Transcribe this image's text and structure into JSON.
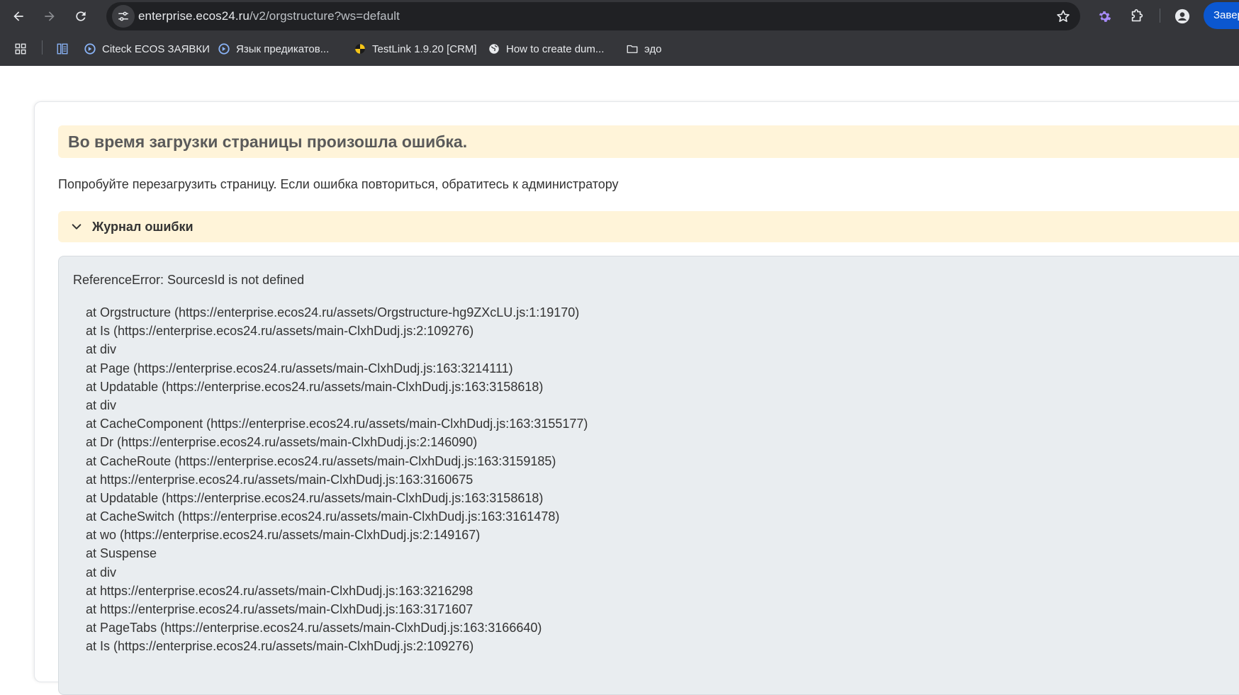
{
  "browser": {
    "url_host": "enterprise.ecos24.ru",
    "url_path": "/v2/orgstructure?ws=default",
    "finish_button_label": "Завер",
    "accent_color": "#0b57d0",
    "bookmarks": [
      {
        "label": "",
        "icon": "apps-grid-icon"
      },
      {
        "label": "",
        "icon": "reading-list-icon"
      },
      {
        "label": "Citeck ECOS ЗАЯВКИ",
        "icon": "citeck-logo-icon"
      },
      {
        "label": "Язык предикатов...",
        "icon": "citeck-logo-icon"
      },
      {
        "label": "TestLink 1.9.20 [CRM]",
        "icon": "testlink-logo-icon"
      },
      {
        "label": "How to create dum...",
        "icon": "globe-icon"
      },
      {
        "label": "эдо",
        "icon": "folder-icon"
      }
    ]
  },
  "error_page": {
    "title": "Во время загрузки страницы произошла ошибка.",
    "hint": "Попробуйте перезагрузить страницу. Если ошибка повториться, обратитесь к администратору",
    "log_toggle_label": "Журнал ошибки",
    "banner_color": "#fff4d9",
    "log_message": "ReferenceError: SourcesId is not defined",
    "stack": [
      "at Orgstructure (https://enterprise.ecos24.ru/assets/Orgstructure-hg9ZXcLU.js:1:19170)",
      "at Is (https://enterprise.ecos24.ru/assets/main-ClxhDudj.js:2:109276)",
      "at div",
      "at Page (https://enterprise.ecos24.ru/assets/main-ClxhDudj.js:163:3214111)",
      "at Updatable (https://enterprise.ecos24.ru/assets/main-ClxhDudj.js:163:3158618)",
      "at div",
      "at CacheComponent (https://enterprise.ecos24.ru/assets/main-ClxhDudj.js:163:3155177)",
      "at Dr (https://enterprise.ecos24.ru/assets/main-ClxhDudj.js:2:146090)",
      "at CacheRoute (https://enterprise.ecos24.ru/assets/main-ClxhDudj.js:163:3159185)",
      "at https://enterprise.ecos24.ru/assets/main-ClxhDudj.js:163:3160675",
      "at Updatable (https://enterprise.ecos24.ru/assets/main-ClxhDudj.js:163:3158618)",
      "at CacheSwitch (https://enterprise.ecos24.ru/assets/main-ClxhDudj.js:163:3161478)",
      "at wo (https://enterprise.ecos24.ru/assets/main-ClxhDudj.js:2:149167)",
      "at Suspense",
      "at div",
      "at https://enterprise.ecos24.ru/assets/main-ClxhDudj.js:163:3216298",
      "at https://enterprise.ecos24.ru/assets/main-ClxhDudj.js:163:3171607",
      "at PageTabs (https://enterprise.ecos24.ru/assets/main-ClxhDudj.js:163:3166640)",
      "at Is (https://enterprise.ecos24.ru/assets/main-ClxhDudj.js:2:109276)"
    ]
  }
}
